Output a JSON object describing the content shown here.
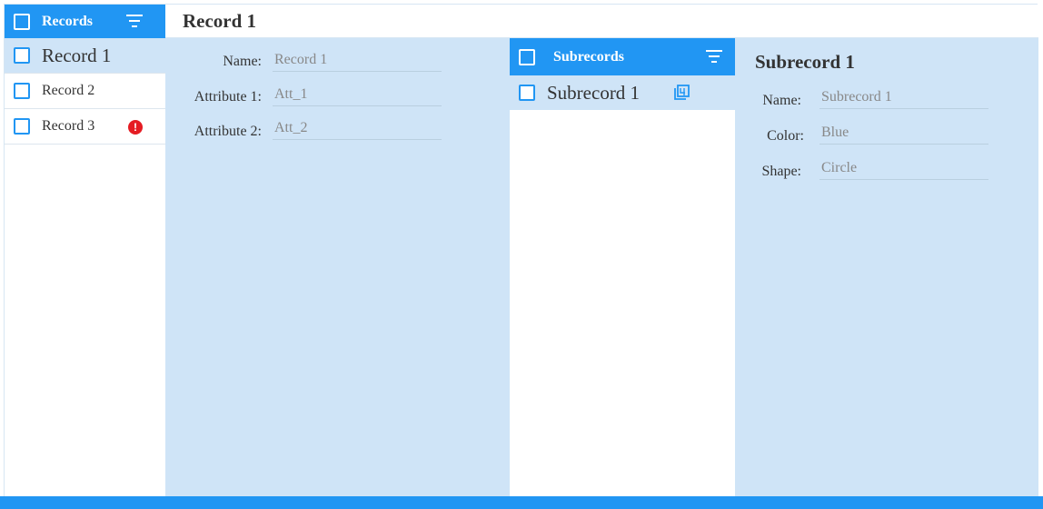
{
  "records": {
    "header_title": "Records",
    "items": [
      {
        "label": "Record 1",
        "selected": true,
        "alert": false
      },
      {
        "label": "Record 2",
        "selected": false,
        "alert": false
      },
      {
        "label": "Record 3",
        "selected": false,
        "alert": true
      }
    ]
  },
  "record_detail": {
    "title": "Record 1",
    "fields": [
      {
        "label": "Name:",
        "value": "Record 1"
      },
      {
        "label": "Attribute 1:",
        "value": "Att_1"
      },
      {
        "label": "Attribute 2:",
        "value": "Att_2"
      }
    ]
  },
  "subrecords": {
    "header_title": "Subrecords",
    "items": [
      {
        "label": "Subrecord 1",
        "selected": true
      }
    ]
  },
  "subrecord_detail": {
    "title": "Subrecord 1",
    "fields": [
      {
        "label": "Name:",
        "value": "Subrecord 1"
      },
      {
        "label": "Color:",
        "value": "Blue"
      },
      {
        "label": "Shape:",
        "value": "Circle"
      }
    ]
  },
  "icons": {
    "filter": "filter-icon",
    "alert": "alert-icon",
    "copy": "copy-icon",
    "checkbox": "checkbox-icon"
  },
  "colors": {
    "accent": "#2196f3",
    "selected_bg": "#cfe4f7",
    "alert": "#e51c23"
  }
}
